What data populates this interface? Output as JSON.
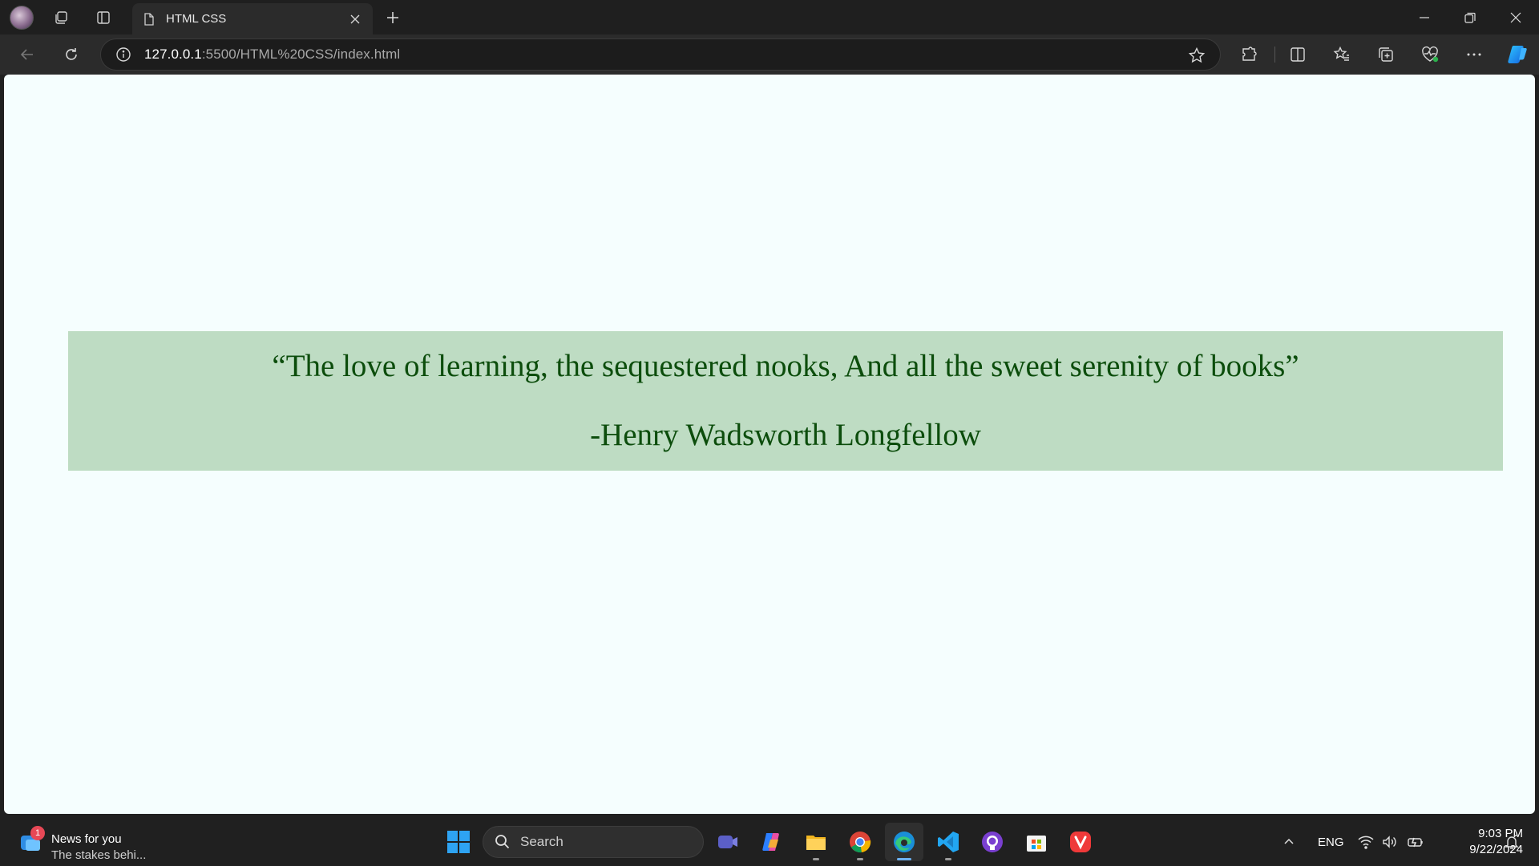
{
  "browser": {
    "tab": {
      "title": "HTML CSS"
    },
    "address": {
      "host": "127.0.0.1",
      "rest": ":5500/HTML%20CSS/index.html"
    }
  },
  "page": {
    "background": "#f5fefe",
    "quote": {
      "text": "“The love of learning, the sequestered nooks, And all the sweet serenity of books”",
      "author": "-Henry Wadsworth Longfellow",
      "box_color": "#bedcc3",
      "text_color": "#0c4d0c"
    }
  },
  "taskbar": {
    "news": {
      "badge": "1",
      "title": "News for you",
      "subtitle": "The stakes behi..."
    },
    "search_placeholder": "Search",
    "apps": [
      "meet-now",
      "copilot",
      "file-explorer",
      "chrome",
      "edge",
      "vs-code",
      "github-desktop",
      "microsoft-store",
      "vivaldi"
    ],
    "tray": {
      "language": "ENG",
      "time": "9:03 PM",
      "date": "9/22/2024"
    }
  }
}
